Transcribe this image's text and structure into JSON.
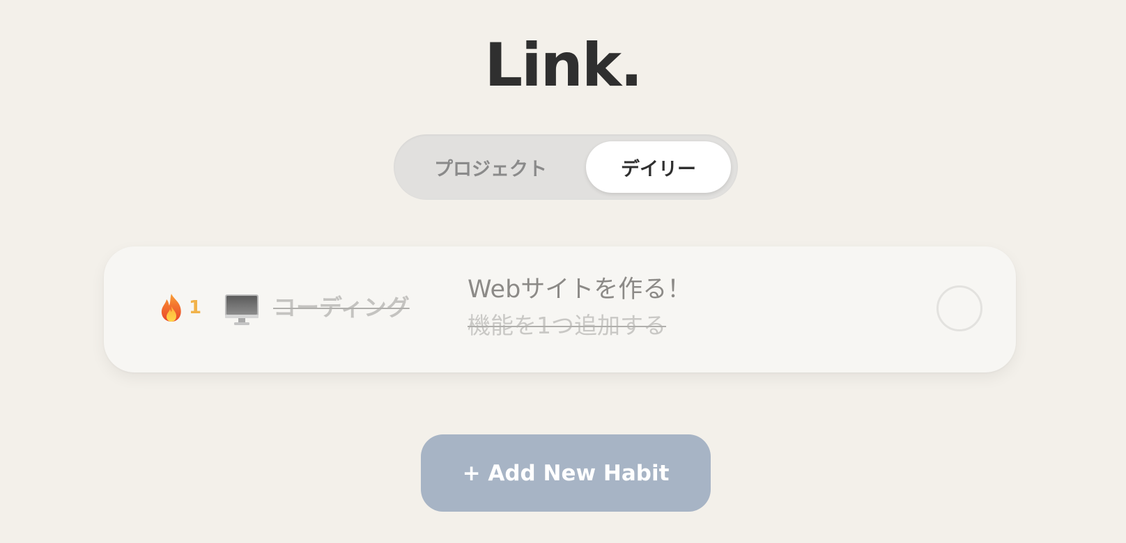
{
  "app": {
    "title": "Link."
  },
  "view_toggle": {
    "options": [
      {
        "label": "プロジェクト",
        "selected": false
      },
      {
        "label": "デイリー",
        "selected": true
      }
    ]
  },
  "habits": [
    {
      "streak_icon": "fire-icon",
      "streak_count": "1",
      "category_icon": "desktop-computer-icon",
      "name": "コーディング",
      "goal_title": "Webサイトを作る！",
      "subtask": "機能を1つ追加する",
      "completed": false
    }
  ],
  "actions": {
    "add_habit_label": "+ Add New Habit"
  },
  "colors": {
    "background": "#f3f0ea",
    "title": "#2f2f2f",
    "streak": "#f1b24a",
    "add_button": "#a7b4c5",
    "card": "#f7f6f3"
  }
}
